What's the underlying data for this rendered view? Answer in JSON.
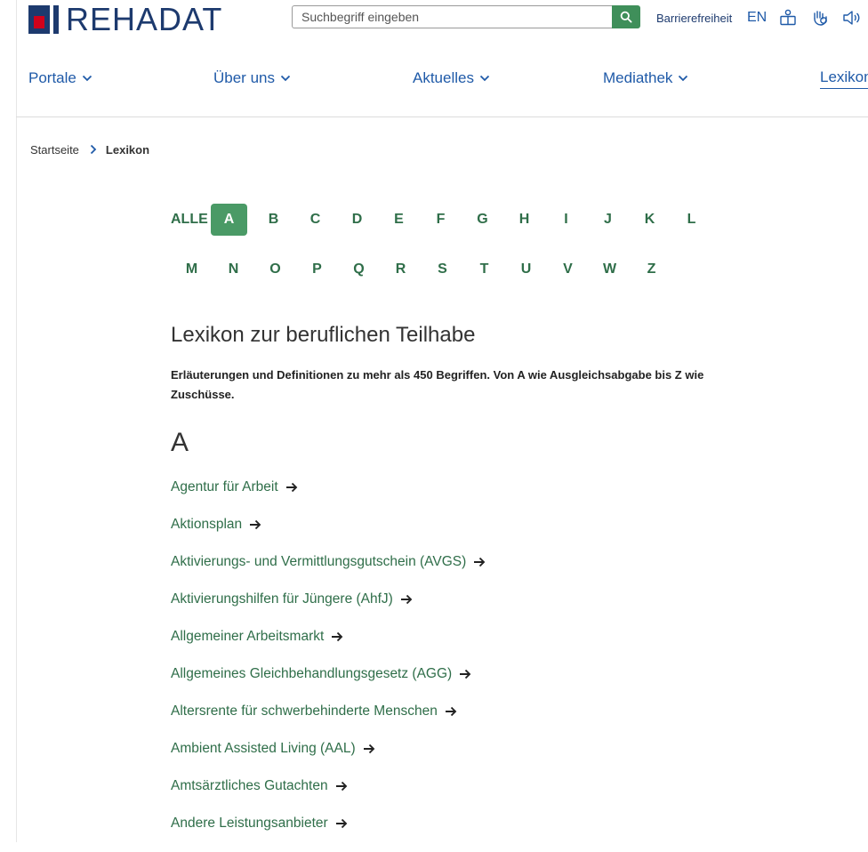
{
  "header": {
    "logo_text": "REHADAT",
    "search": {
      "placeholder": "Suchbegriff eingeben"
    },
    "utility": {
      "barrierefreiheit": "Barrierefreiheit",
      "language": "EN"
    },
    "colors": {
      "brand": "#1d3a6e",
      "accent_red": "#d0021b",
      "green": "#3f8f5a",
      "link_blue": "#1f5aa8"
    }
  },
  "nav": {
    "items": [
      {
        "label": "Portale"
      },
      {
        "label": "Über uns"
      },
      {
        "label": "Aktuelles"
      },
      {
        "label": "Mediathek"
      },
      {
        "label": "Lexikon"
      }
    ]
  },
  "breadcrumb": {
    "home": "Startseite",
    "current": "Lexikon"
  },
  "alphabet": {
    "row1": [
      "ALLE",
      "A",
      "B",
      "C",
      "D",
      "E",
      "F",
      "G",
      "H",
      "I",
      "J",
      "K",
      "L"
    ],
    "row2": [
      "M",
      "N",
      "O",
      "P",
      "Q",
      "R",
      "S",
      "T",
      "U",
      "V",
      "W",
      "Z"
    ],
    "active": "A"
  },
  "main": {
    "title": "Lexikon zur beruflichen Teilhabe",
    "intro": "Erläuterungen und Definitionen zu mehr als 450 Begriffen. Von A wie Ausgleichsabgabe bis Z wie Zuschüsse.",
    "section_letter": "A",
    "terms": [
      "Agentur für Arbeit",
      "Aktionsplan",
      "Aktivierungs- und Vermittlungsgutschein (AVGS)",
      "Aktivierungshilfen für Jüngere (AhfJ)",
      "Allgemeiner Arbeitsmarkt",
      "Allgemeines Gleichbehandlungsgesetz (AGG)",
      "Altersrente für schwerbehinderte Menschen",
      "Ambient Assisted Living (AAL)",
      "Amtsärztliches Gutachten",
      "Andere Leistungsanbieter"
    ]
  }
}
